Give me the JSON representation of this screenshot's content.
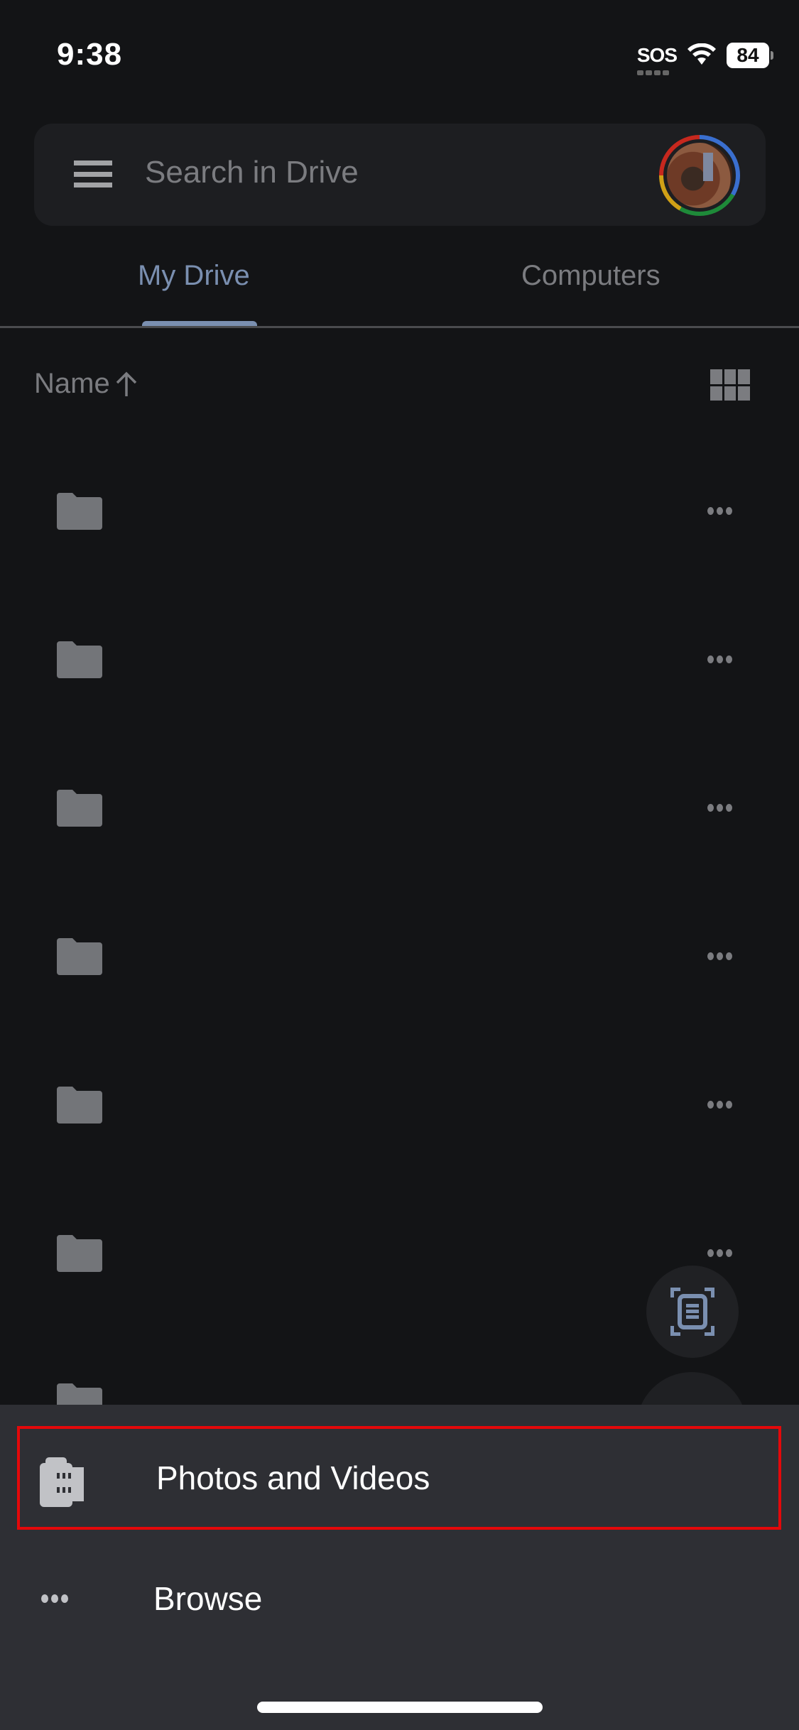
{
  "status_bar": {
    "time": "9:38",
    "signal": "SOS",
    "battery": "84"
  },
  "search": {
    "placeholder": "Search in Drive"
  },
  "tabs": [
    {
      "label": "My Drive",
      "active": true
    },
    {
      "label": "Computers",
      "active": false
    }
  ],
  "sort": {
    "label": "Name",
    "direction": "ascending"
  },
  "files": [
    {
      "type": "folder",
      "name": ""
    },
    {
      "type": "folder",
      "name": ""
    },
    {
      "type": "folder",
      "name": ""
    },
    {
      "type": "folder",
      "name": ""
    },
    {
      "type": "folder",
      "name": ""
    },
    {
      "type": "folder",
      "name": ""
    },
    {
      "type": "folder",
      "name": ""
    }
  ],
  "sheet": {
    "items": [
      {
        "label": "Photos and Videos",
        "icon": "photo-library-icon",
        "highlighted": true
      },
      {
        "label": "Browse",
        "icon": "more-horizontal-icon",
        "highlighted": false
      }
    ]
  },
  "colors": {
    "background": "#131416",
    "accent": "#7a8fb0",
    "sheet": "#2e2f34",
    "highlight": "#e4080a"
  }
}
